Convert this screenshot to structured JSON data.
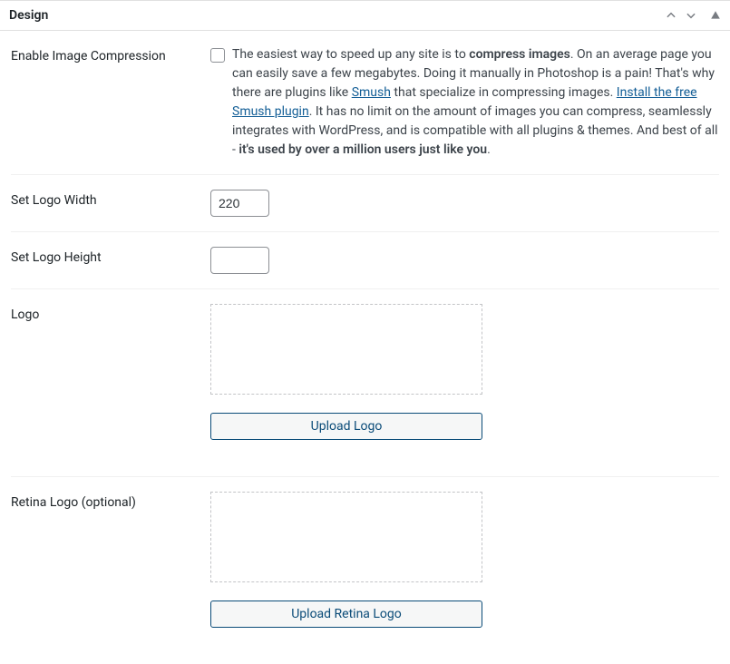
{
  "panel": {
    "title": "Design"
  },
  "compression": {
    "label": "Enable Image Compression",
    "text_pre": "The easiest way to speed up any site is to ",
    "bold1": "compress images",
    "text_mid1": ". On an average page you can easily save a few megabytes. Doing it manually in Photoshop is a pain! That's why there are plugins like ",
    "link1": "Smush",
    "text_mid2": " that specialize in compressing images. ",
    "link2": "Install the free Smush plugin",
    "text_mid3": ". It has no limit on the amount of images you can compress, seamlessly integrates with WordPress, and is compatible with all plugins & themes. And best of all - ",
    "bold2": "it's used by over a million users just like you",
    "text_end": "."
  },
  "logoWidth": {
    "label": "Set Logo Width",
    "value": "220"
  },
  "logoHeight": {
    "label": "Set Logo Height",
    "value": ""
  },
  "logo": {
    "label": "Logo",
    "uploadBtn": "Upload Logo"
  },
  "retinaLogo": {
    "label": "Retina Logo (optional)",
    "uploadBtn": "Upload Retina Logo"
  }
}
